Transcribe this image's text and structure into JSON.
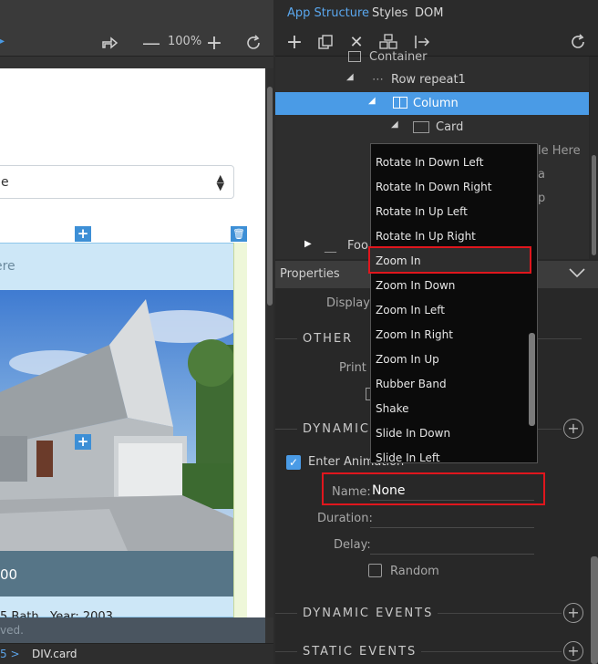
{
  "canvas": {
    "zoom": "100%",
    "select_value": "e",
    "card_header": "ere",
    "price": "00",
    "card_bottom": "5  Bath  ,  Year:  2003",
    "copyright": "ved.",
    "breadcrumb": "DIV.card",
    "breadcrumb_prev": "5 >"
  },
  "tabs": [
    "App Structure",
    "Styles",
    "DOM"
  ],
  "tree": {
    "container": "Container",
    "row_repeat": "Row repeat1",
    "column": "Column",
    "card": "Card",
    "title_here": "le Here",
    "footer": "Foo",
    "partial_a": "a",
    "partial_p": "p"
  },
  "properties": {
    "title": "Properties",
    "display_label": "Display",
    "other_label": "OTHER",
    "print_label": "Print",
    "dynamic_label": "DYNAMIC",
    "enter_animation_label": "Enter Animation",
    "name_label": "Name:",
    "name_value": "None",
    "duration_label": "Duration:",
    "delay_label": "Delay:",
    "random_label": "Random",
    "dynamic_events_label": "DYNAMIC EVENTS",
    "static_events_label": "STATIC EVENTS"
  },
  "dropdown": {
    "items": [
      "Rotate In Down Left",
      "Rotate In Down Right",
      "Rotate In Up Left",
      "Rotate In Up Right",
      "Zoom In",
      "Zoom In Down",
      "Zoom In Left",
      "Zoom In Right",
      "Zoom In Up",
      "Rubber Band",
      "Shake",
      "Slide In Down",
      "Slide In Left"
    ],
    "highlighted": "Zoom In"
  },
  "colors": {
    "accent": "#4a9be6",
    "highlight_border": "#e0161d"
  }
}
